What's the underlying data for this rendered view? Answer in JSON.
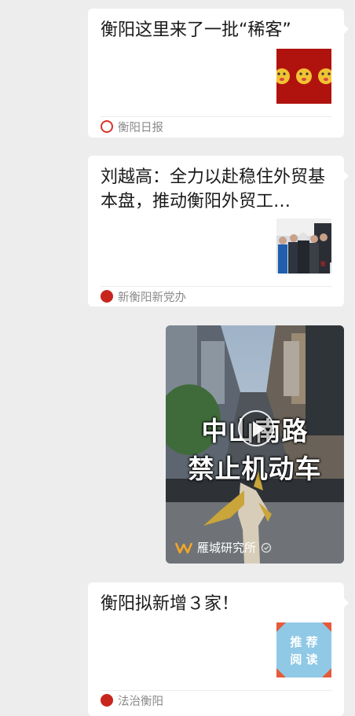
{
  "articles": [
    {
      "title": "衡阳这里来了一批“稀客”",
      "source": "衡阳日报"
    },
    {
      "title": "刘越高：全力以赴稳住外贸基本盘，推动衡阳外贸工…",
      "source": "新衡阳新党办"
    },
    {
      "title": "衡阳拟新增３家！",
      "source": "法治衡阳",
      "thumb_lines": [
        "推 荐",
        "阅 读"
      ]
    }
  ],
  "video": {
    "line1": "中山南路",
    "line2": "禁止机动车",
    "channel": "雁城研究所"
  },
  "colors": {
    "background": "#ededed",
    "card": "#ffffff",
    "source_text": "#8a8a8a"
  }
}
